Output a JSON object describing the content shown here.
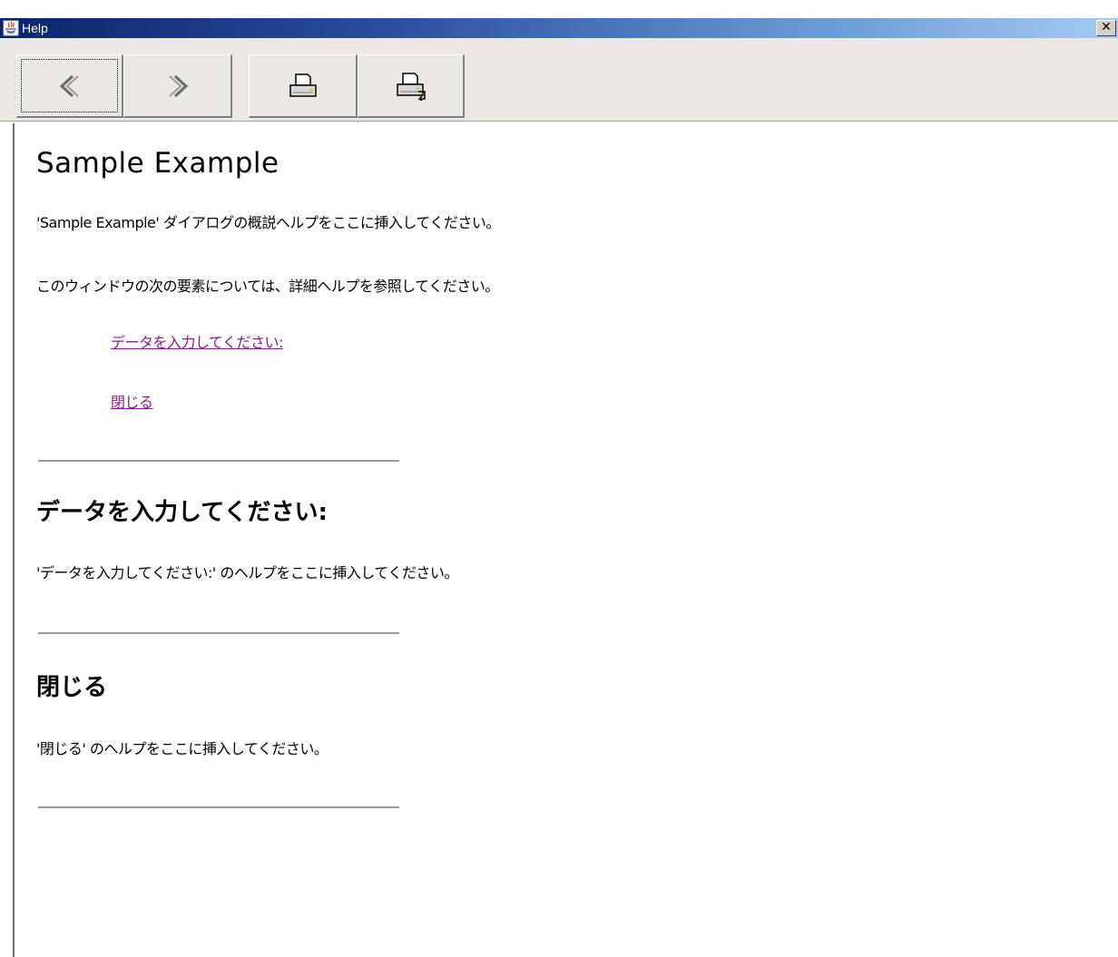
{
  "window": {
    "title": "Help",
    "close_glyph": "✕"
  },
  "toolbar": {
    "buttons": [
      {
        "name": "back",
        "icon": "chevron-left-icon"
      },
      {
        "name": "forward",
        "icon": "chevron-right-icon"
      },
      {
        "name": "print",
        "icon": "printer-icon"
      },
      {
        "name": "page-setup",
        "icon": "printer-setup-icon"
      }
    ]
  },
  "content": {
    "title": "Sample Example",
    "intro": "'Sample Example' ダイアログの概説ヘルプをここに挿入してください。",
    "elements_intro": "このウィンドウの次の要素については、詳細ヘルプを参照してください。",
    "links": [
      {
        "label": "データを入力してください:"
      },
      {
        "label": "閉じる"
      }
    ],
    "sections": [
      {
        "heading": "データを入力してください:",
        "body": "'データを入力してください:' のヘルプをここに挿入してください。"
      },
      {
        "heading": "閉じる",
        "body": "'閉じる' のヘルプをここに挿入してください。"
      }
    ]
  },
  "colors": {
    "link": "#8b1a8b",
    "titlebar_start": "#0a246a",
    "titlebar_end": "#a6caf0",
    "toolbar_bg": "#ebe8e4"
  }
}
